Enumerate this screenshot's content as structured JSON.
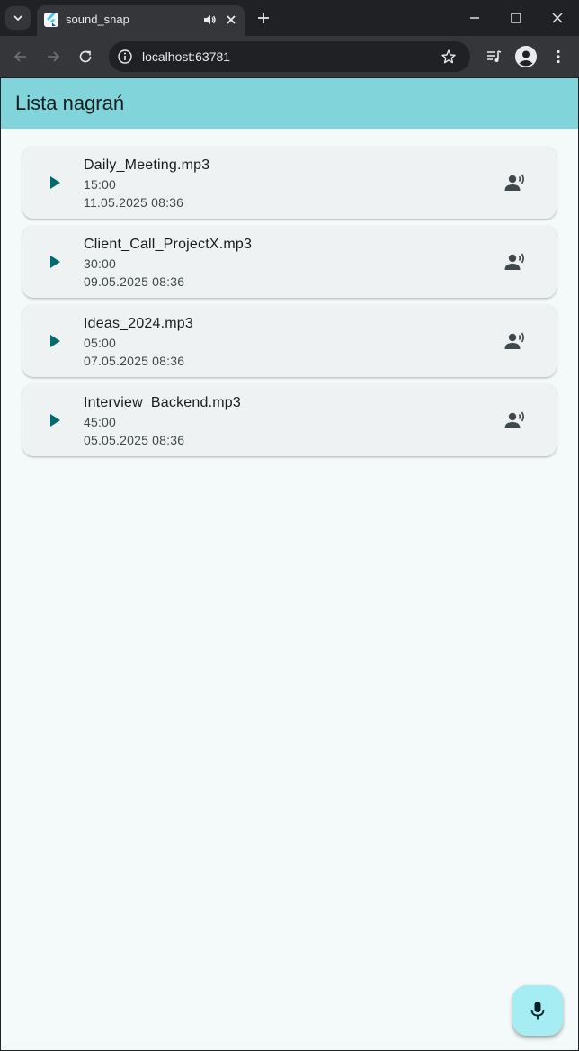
{
  "browser": {
    "tab_title": "sound_snap",
    "url": "localhost:63781"
  },
  "app": {
    "title": "Lista nagrań",
    "accent": "#80d4da",
    "play_color": "#006a71",
    "fab_color": "#a5edf3"
  },
  "recordings": [
    {
      "name": "Daily_Meeting.mp3",
      "duration": "15:00",
      "date": "11.05.2025 08:36"
    },
    {
      "name": "Client_Call_ProjectX.mp3",
      "duration": "30:00",
      "date": "09.05.2025 08:36"
    },
    {
      "name": "Ideas_2024.mp3",
      "duration": "05:00",
      "date": "07.05.2025 08:36"
    },
    {
      "name": "Interview_Backend.mp3",
      "duration": "45:00",
      "date": "05.05.2025 08:36"
    }
  ],
  "icons": {
    "play": "play-icon",
    "speaker": "record-voice-icon",
    "fab": "mic-icon"
  }
}
